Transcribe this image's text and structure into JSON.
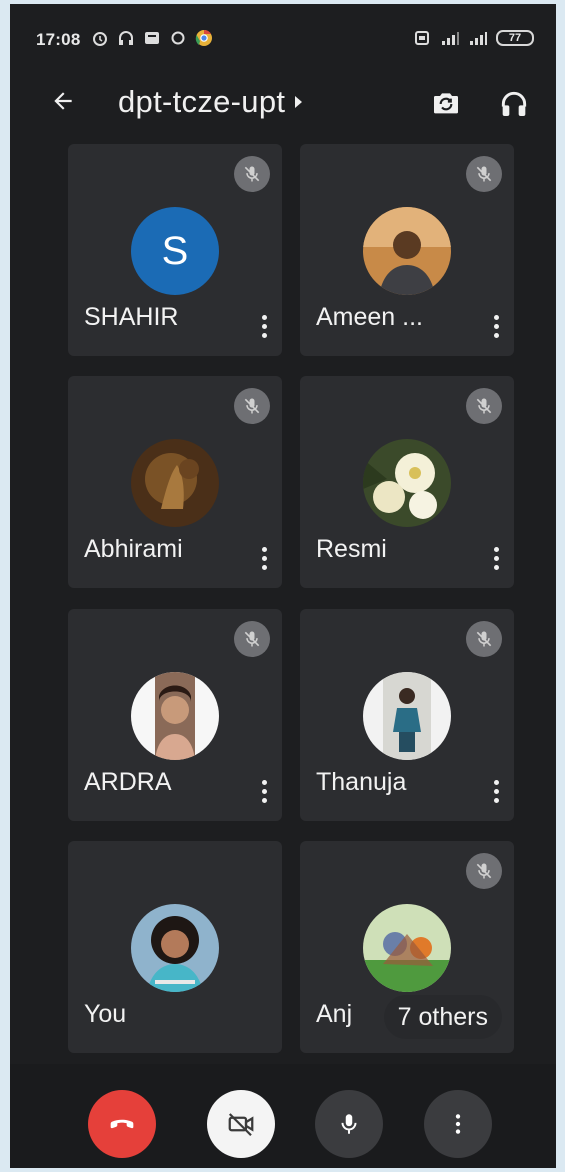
{
  "status_bar": {
    "time": "17:08",
    "battery": "77"
  },
  "header": {
    "meeting_code": "dpt-tcze-upt",
    "back_icon": "arrow-back-icon",
    "switch_camera_icon": "switch-camera-icon",
    "audio_icon": "headphones-icon"
  },
  "participants": [
    {
      "name": "SHAHIR",
      "avatar_letter": "S",
      "muted": true
    },
    {
      "name": "Ameen ...",
      "muted": true
    },
    {
      "name": "Abhirami",
      "muted": true
    },
    {
      "name": "Resmi",
      "muted": true
    },
    {
      "name": "ARDRA",
      "muted": true
    },
    {
      "name": "Thanuja",
      "muted": true
    },
    {
      "name": "You",
      "muted": false
    },
    {
      "name": "Anj",
      "muted": true,
      "others_label": "7 others"
    }
  ],
  "controls": {
    "end_call_icon": "end-call-icon",
    "camera_icon": "camera-off-icon",
    "mic_icon": "microphone-icon",
    "more_icon": "more-vertical-icon"
  },
  "colors": {
    "background": "#1d1e20",
    "tile": "#2c2d30",
    "end_call": "#e5403a",
    "avatar_blue": "#1b6bb5"
  }
}
